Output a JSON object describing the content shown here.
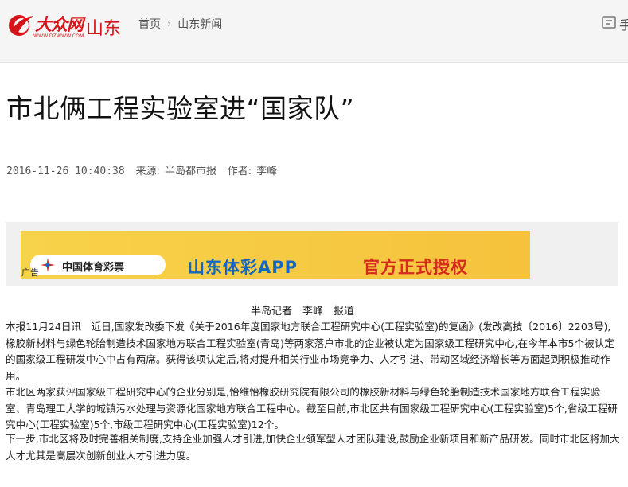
{
  "header": {
    "logo_text": "大众网",
    "logo_url": "WWW.DZWWW.COM",
    "region": "山东",
    "breadcrumb": [
      "首页",
      "山东新闻"
    ],
    "cut_label": "手"
  },
  "article": {
    "title": "市北俩工程实验室进“国家队”",
    "datetime": "2016-11-26 10:40:38",
    "source_label": "来源:",
    "source": "半岛都市报",
    "author_label": "作者:",
    "author": "李峰"
  },
  "ad": {
    "lottery": "中国体育彩票",
    "app": "山东体彩APP",
    "auth": "官方正式授权",
    "tag": "广告"
  },
  "body": {
    "byline": "半岛记者　李峰　报道",
    "paragraphs": [
      "本报11月24日讯　近日,国家发改委下发《关于2016年度国家地方联合工程研究中心(工程实验室)的复函》(发改高技〔2016〕2203号),橡胶新材料与绿色轮胎制造技术国家地方联合工程实验室(青岛)等两家落户市北的企业被认定为国家级工程研究中心,在今年本市5个被认定的国家级工程研发中心中占有两席。获得该项认定后,将对提升相关行业市场竞争力、人才引进、带动区域经济增长等方面起到积极推动作用。",
      "市北区两家获评国家级工程研究中心的企业分别是,怡维怡橡胶研究院有限公司的橡胶新材料与绿色轮胎制造技术国家地方联合工程实验室、青岛理工大学的城镇污水处理与资源化国家地方联合工程中心。截至目前,市北区共有国家级工程研究中心(工程实验室)5个,省级工程研究中心(工程实验室)5个,市级工程研究中心(工程实验室)12个。",
      "下一步,市北区将及时完善相关制度,支持企业加强人才引进,加快企业领军型人才团队建设,鼓励企业新项目和新产品研发。同时市北区将加大人才尤其是高层次创新创业人才引进力度。"
    ]
  },
  "colors": {
    "brand_red": "#d7141a",
    "ad_yellow": "#f7d34a",
    "ad_blue": "#1566c0",
    "ad_red": "#d72a1f"
  }
}
